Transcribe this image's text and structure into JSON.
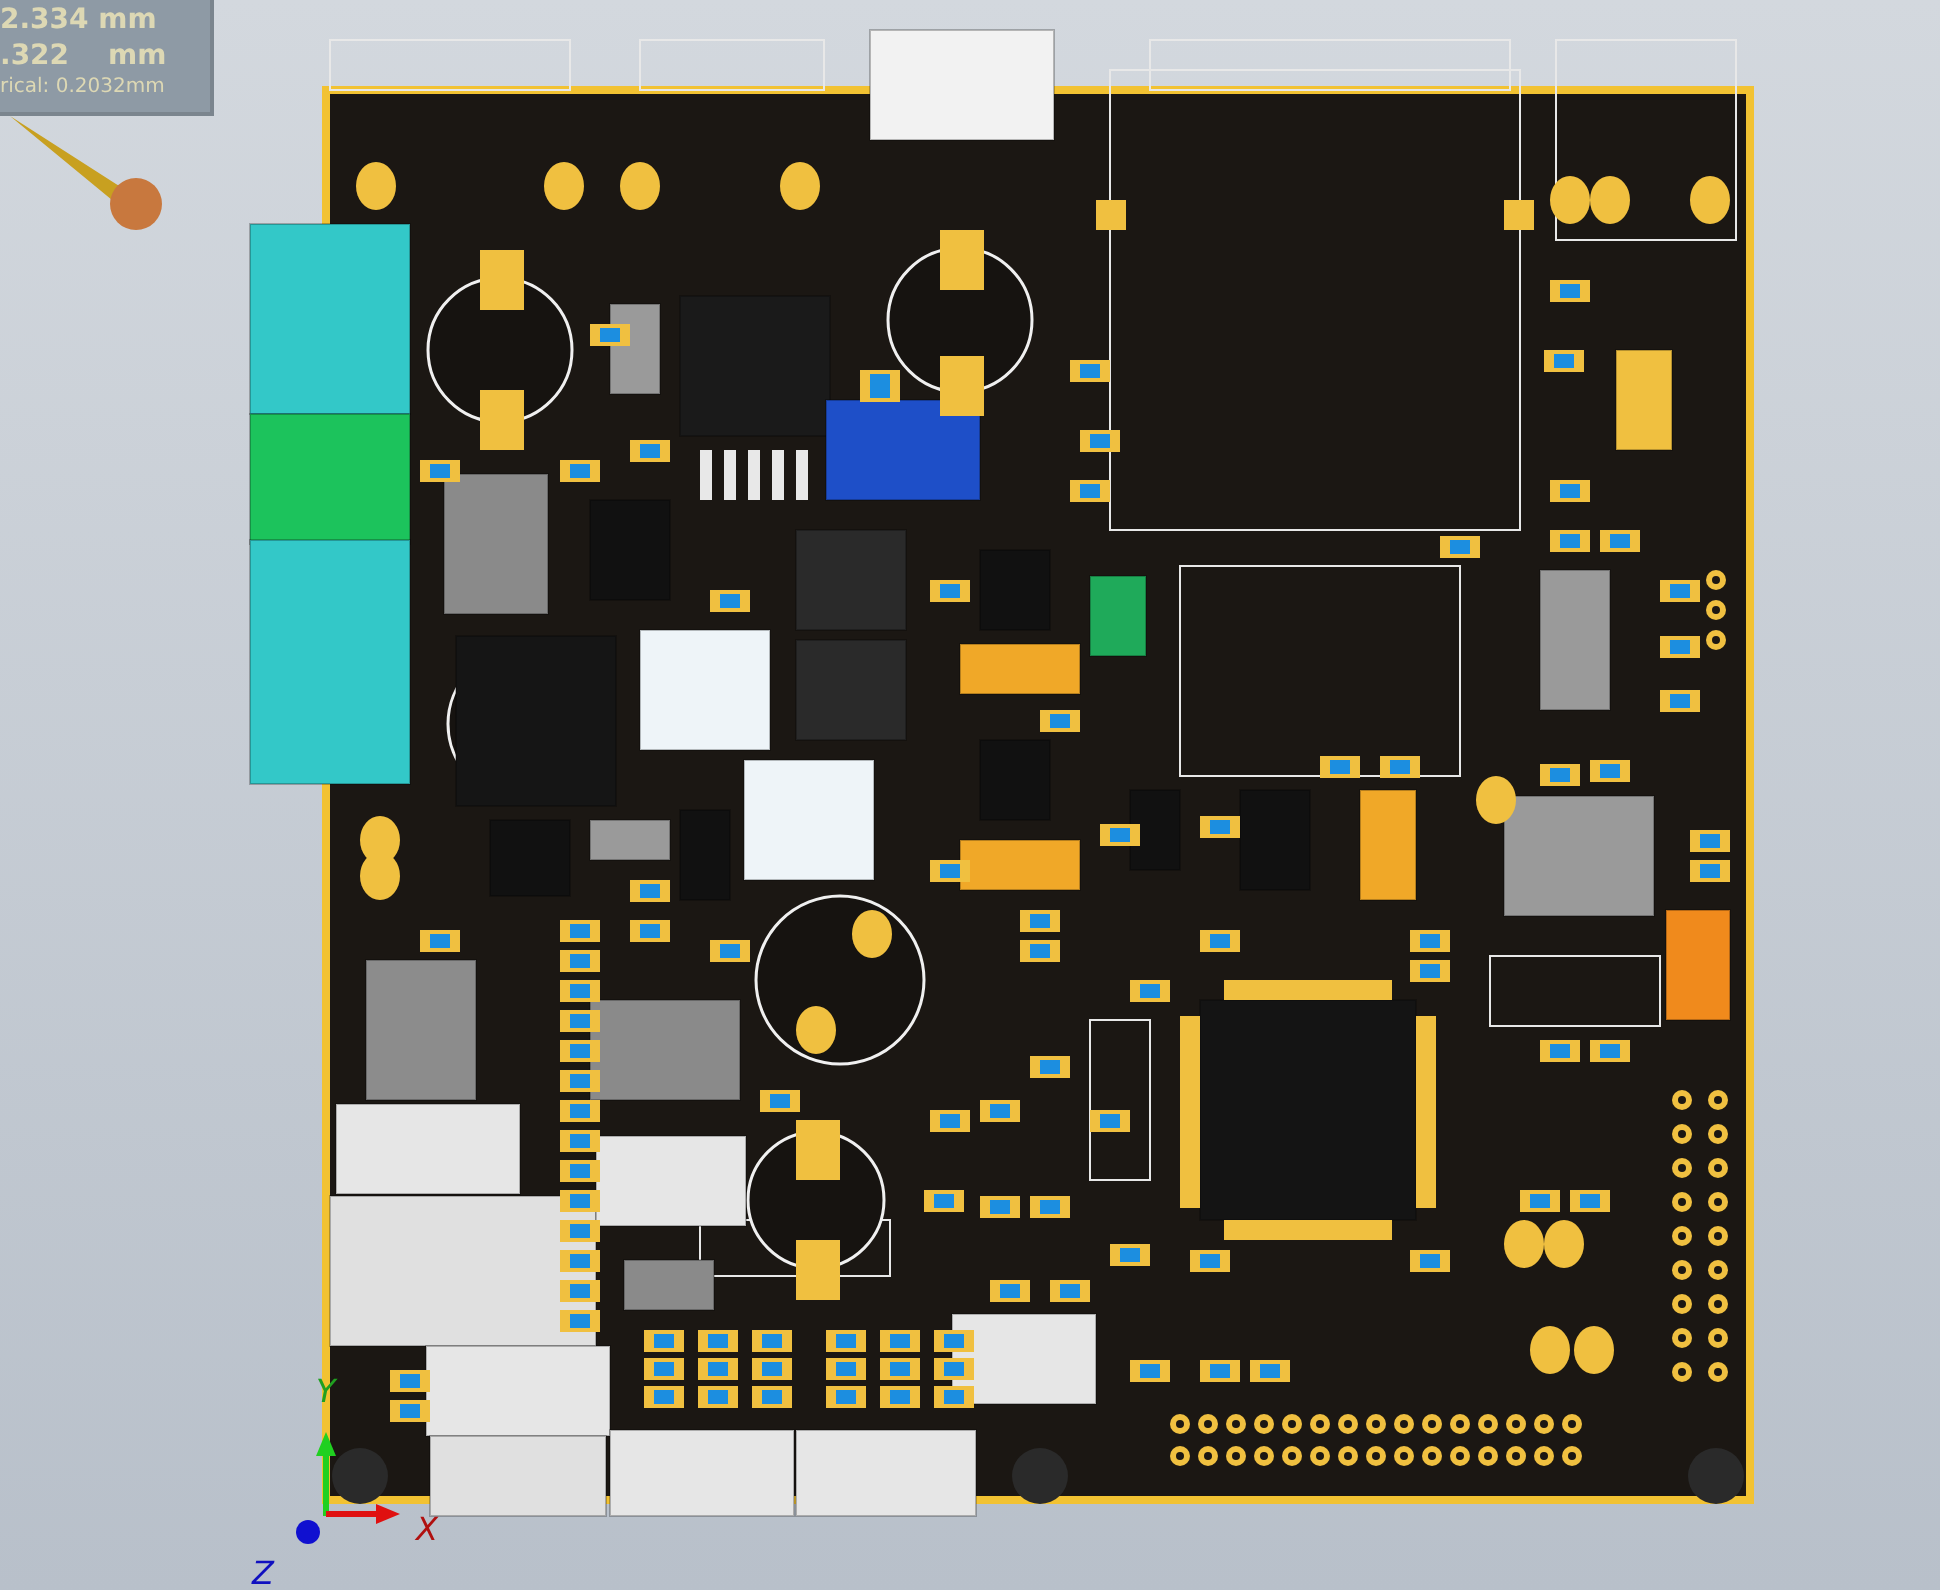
{
  "info_box": {
    "lines": [
      "2.334 mm",
      ".322    mm",
      "rical: 0.2032mm"
    ]
  },
  "axes": [
    {
      "label": "Y"
    },
    {
      "label": "X"
    },
    {
      "label": "Z"
    }
  ]
}
